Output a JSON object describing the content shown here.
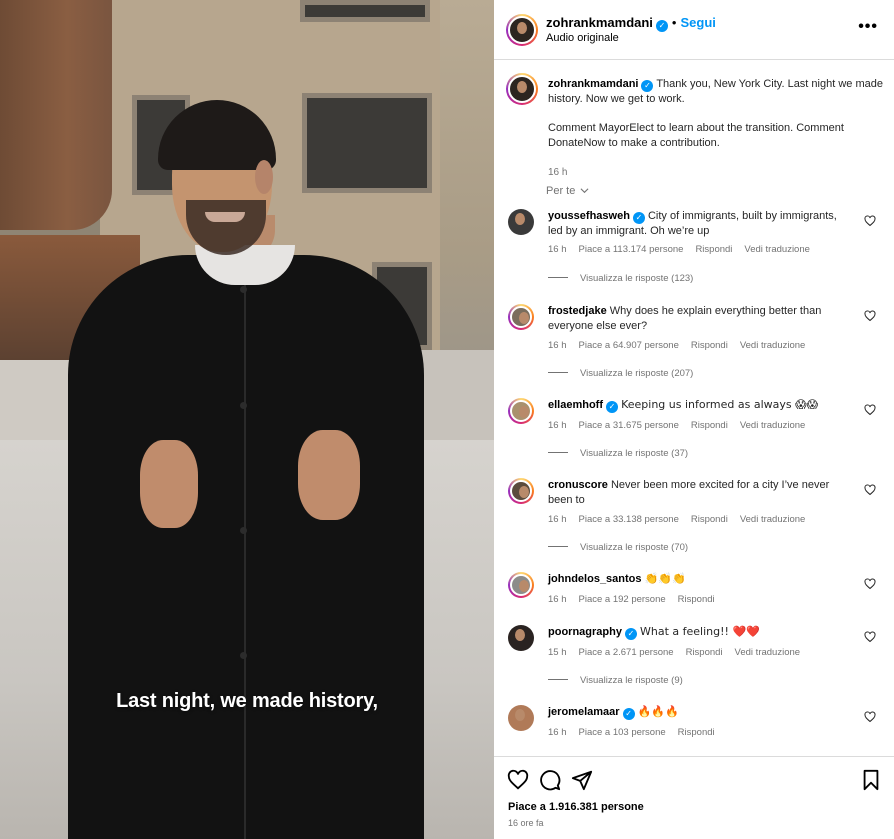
{
  "video": {
    "subtitle": "Last night, we made history,"
  },
  "header": {
    "username": "zohrankmamdani",
    "follow_label": "Segui",
    "audio_label": "Audio originale",
    "more_label": "•••"
  },
  "post": {
    "username": "zohrankmamdani",
    "caption_line1": "Thank you, New York City. Last night we made history. Now we get to work.",
    "caption_line2": "Comment MayorElect to learn about the transition. Comment DonateNow to make a contribution.",
    "time": "16 h",
    "sort_label": "Per te"
  },
  "comments": [
    {
      "username": "youssefhasweh",
      "verified": true,
      "text": "City of immigrants, built by immigrants, led by an immigrant. Oh we’re up",
      "time": "16 h",
      "likes": "Piace a 113.174 persone",
      "reply": "Rispondi",
      "translate": "Vedi traduzione",
      "replies": "Visualizza le risposte (123)"
    },
    {
      "username": "frostedjake",
      "verified": false,
      "text": "Why does he explain everything better than everyone else ever?",
      "time": "16 h",
      "likes": "Piace a 64.907 persone",
      "reply": "Rispondi",
      "translate": "Vedi traduzione",
      "replies": "Visualizza le risposte (207)"
    },
    {
      "username": "ellaemhoff",
      "verified": true,
      "text": "Keeping us informed as always 😱😱",
      "time": "16 h",
      "likes": "Piace a 31.675 persone",
      "reply": "Rispondi",
      "translate": "Vedi traduzione",
      "replies": "Visualizza le risposte (37)"
    },
    {
      "username": "cronuscore",
      "verified": false,
      "text": "Never been more excited for a city I’ve never been to",
      "time": "16 h",
      "likes": "Piace a 33.138 persone",
      "reply": "Rispondi",
      "translate": "Vedi traduzione",
      "replies": "Visualizza le risposte (70)"
    },
    {
      "username": "johndelos_santos",
      "verified": false,
      "text": "👏👏👏",
      "time": "16 h",
      "likes": "Piace a 192 persone",
      "reply": "Rispondi",
      "translate": "",
      "replies": ""
    },
    {
      "username": "poornagraphy",
      "verified": true,
      "text": "What a feeling!! ❤️❤️",
      "time": "15 h",
      "likes": "Piace a 2.671 persone",
      "reply": "Rispondi",
      "translate": "Vedi traduzione",
      "replies": "Visualizza le risposte (9)"
    },
    {
      "username": "jeromelamaar",
      "verified": true,
      "text": "🔥🔥🔥",
      "time": "16 h",
      "likes": "Piace a 103 persone",
      "reply": "Rispondi",
      "translate": "",
      "replies": ""
    }
  ],
  "footer": {
    "likes": "Piace a 1.916.381 persone",
    "ago": "16 ore fa"
  },
  "colors": {
    "accent": "#0095f6",
    "muted": "#737373",
    "border": "#dbdbdb"
  },
  "icons": [
    "heart-icon",
    "comment-icon",
    "share-icon",
    "bookmark-icon",
    "verified-icon",
    "chevron-down-icon",
    "more-icon"
  ]
}
